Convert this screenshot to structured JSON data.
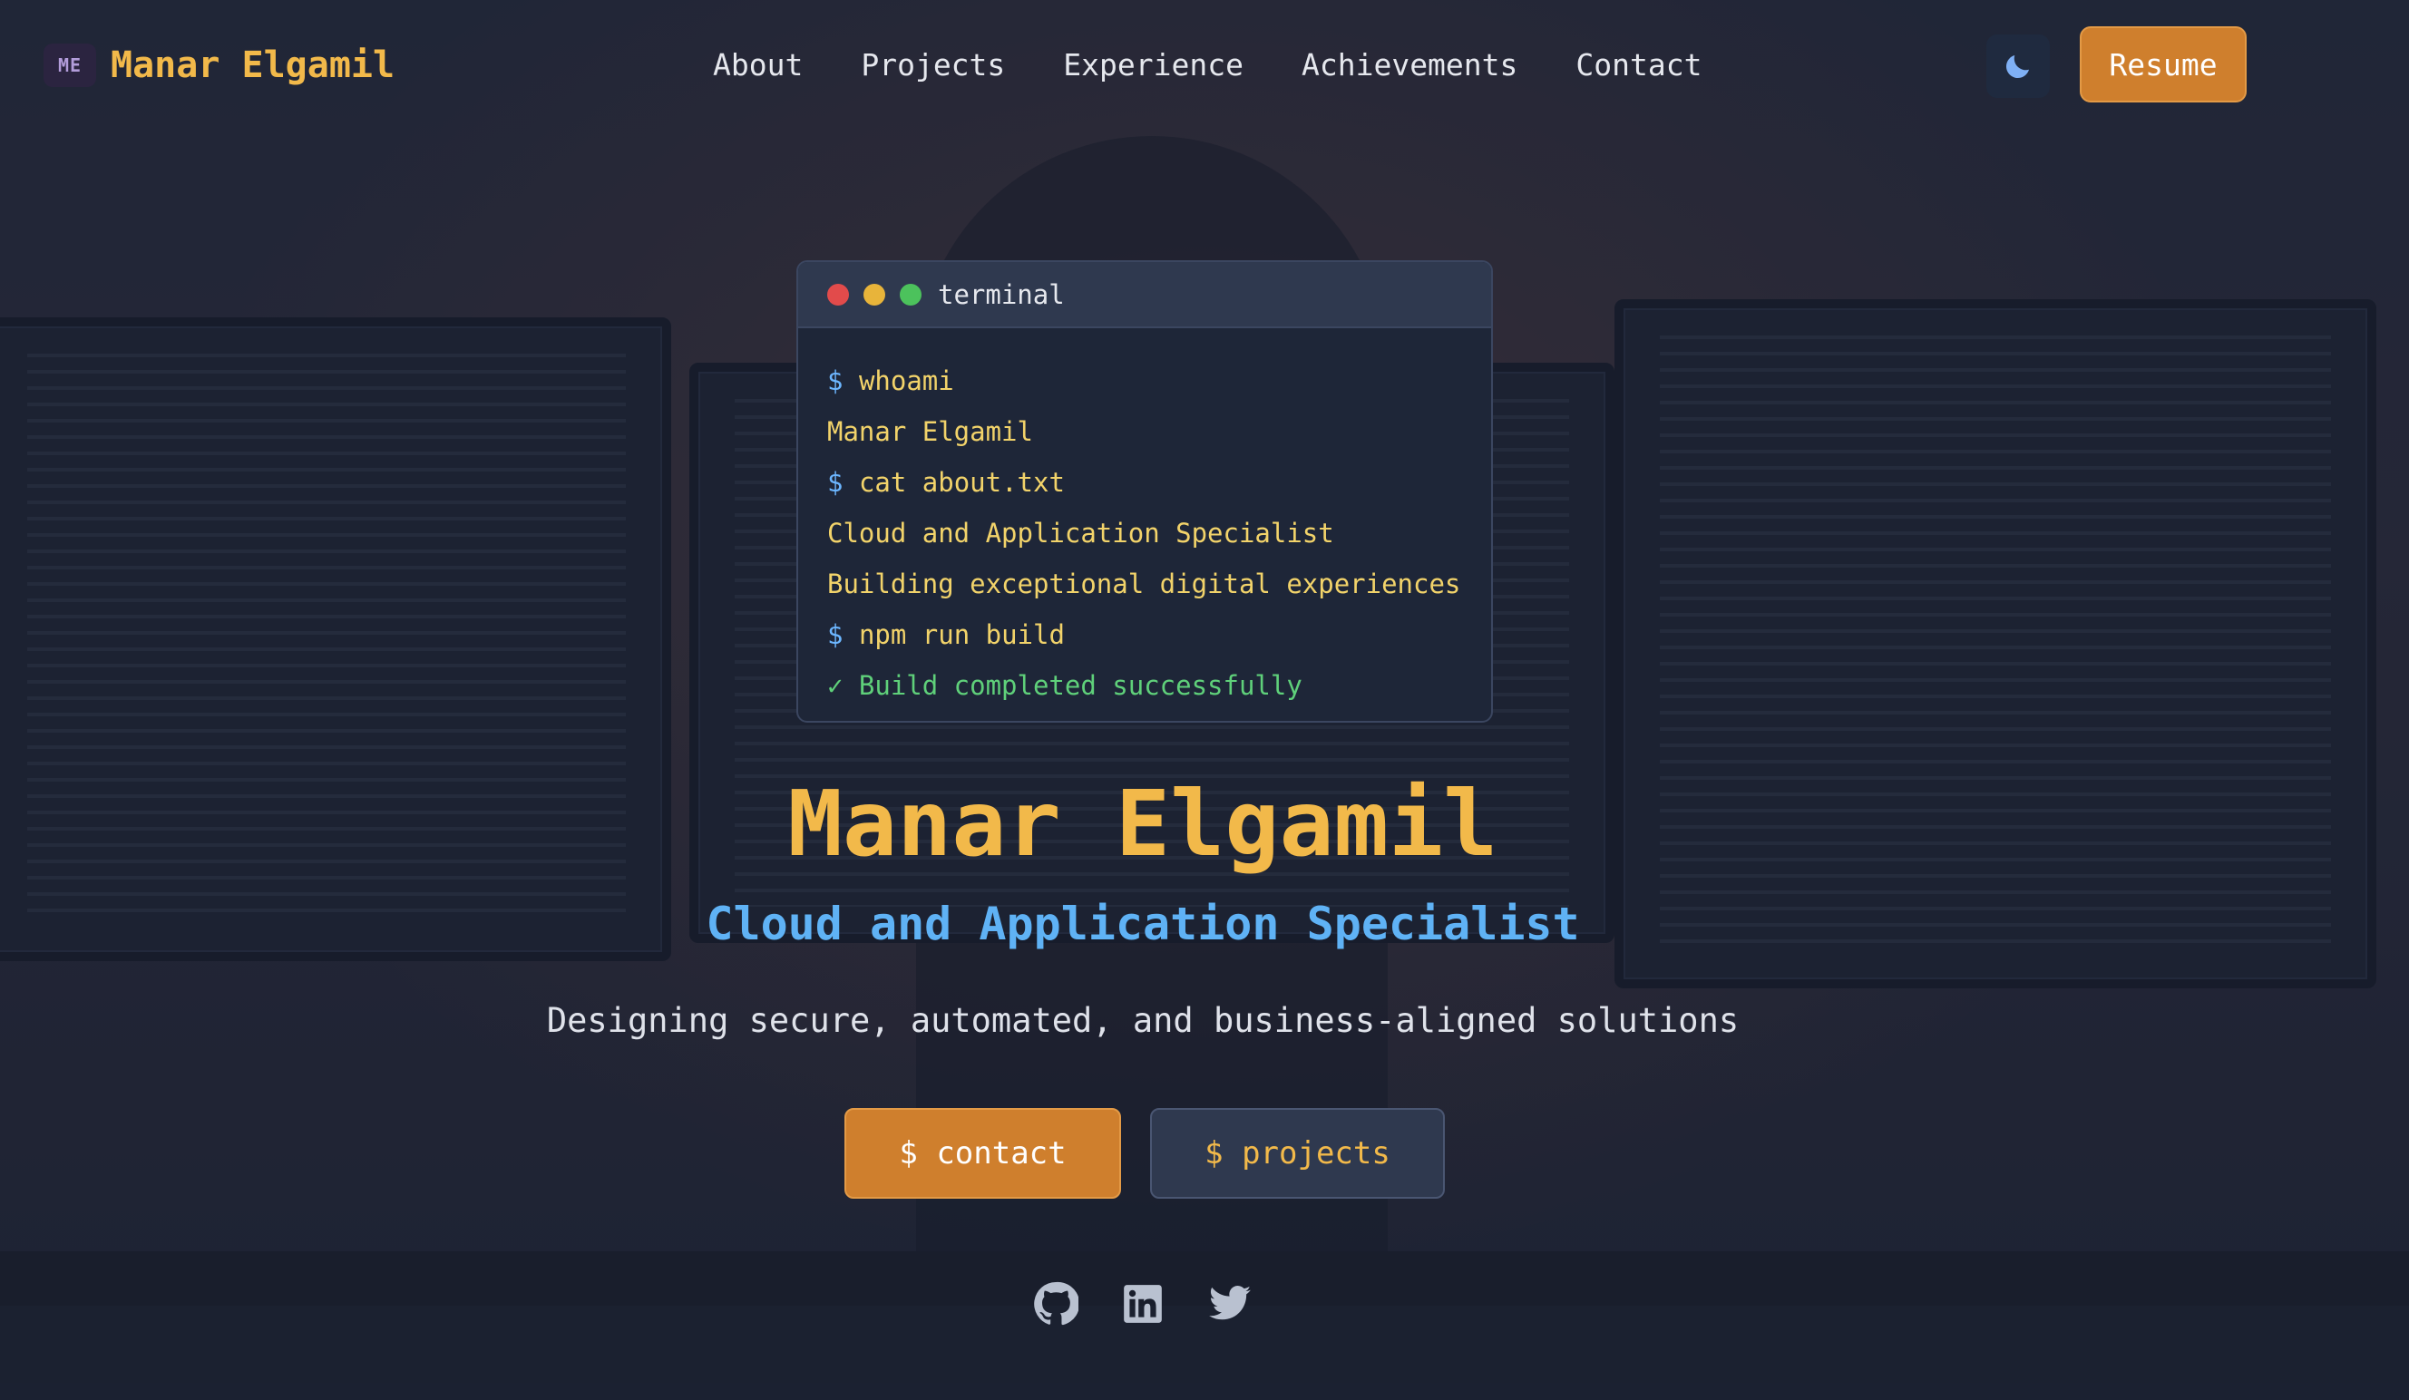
{
  "brand": {
    "logo_text": "ME",
    "name": "Manar Elgamil"
  },
  "nav": {
    "items": [
      "About",
      "Projects",
      "Experience",
      "Achievements",
      "Contact"
    ],
    "theme_toggle_icon": "moon-icon",
    "resume_label": "Resume"
  },
  "terminal": {
    "title": "terminal",
    "lines": [
      {
        "prompt": "$",
        "text": "whoami"
      },
      {
        "prompt": "",
        "text": "Manar Elgamil"
      },
      {
        "prompt": "$",
        "text": "cat about.txt"
      },
      {
        "prompt": "",
        "text": "Cloud and Application Specialist"
      },
      {
        "prompt": "",
        "text": "Building exceptional digital experiences"
      },
      {
        "prompt": "$",
        "text": "npm run build"
      },
      {
        "prompt": "",
        "text": "✓ Build completed successfully"
      }
    ]
  },
  "hero": {
    "name": "Manar Elgamil",
    "title": "Cloud and Application Specialist",
    "tagline": "Designing secure, automated, and business-aligned solutions",
    "contact_button": "$ contact",
    "projects_button": "$ projects"
  },
  "socials": [
    "github-icon",
    "linkedin-icon",
    "twitter-icon"
  ],
  "colors": {
    "accent": "#f2b94a",
    "button_orange": "#cf7f2d",
    "title_blue": "#5fb2f5",
    "success_green": "#5fd07a"
  }
}
